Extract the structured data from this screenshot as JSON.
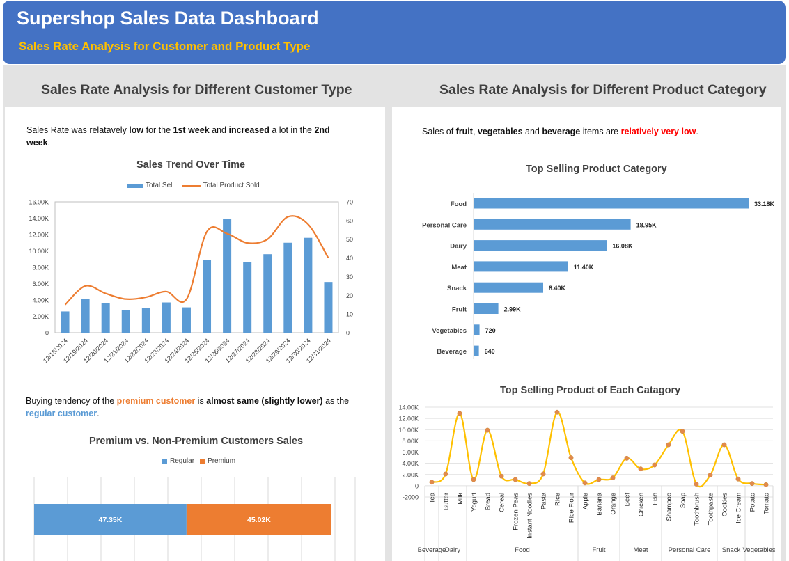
{
  "header": {
    "title": "Supershop Sales Data Dashboard",
    "subtitle": "Sales Rate Analysis for Customer and Product Type"
  },
  "left": {
    "section_title": "Sales Rate Analysis for Different Customer Type",
    "note1": {
      "parts": [
        "Sales Rate was relatavely ",
        "low",
        " for the ",
        "1st week",
        " and ",
        "increased",
        " a lot in the ",
        "2nd week",
        "."
      ]
    },
    "note2": {
      "parts": [
        "Buying tendency of the ",
        "premium customer",
        " is ",
        "almost same (slightly lower)",
        " as the ",
        "regular customer",
        "."
      ]
    }
  },
  "right": {
    "section_title": "Sales Rate Analysis for Different Product Category",
    "note": {
      "parts": [
        "Sales of ",
        "fruit",
        ", ",
        "vegetables",
        " and ",
        "beverage",
        " items are ",
        "relatively very low",
        "."
      ]
    }
  },
  "colors": {
    "header_bg": "#4472c4",
    "subtitle": "#ffc000",
    "bar_blue": "#5b9bd5",
    "orange": "#ed7d31",
    "gold_line": "#ffc000",
    "red_text": "#ff0000"
  },
  "chart_data": [
    {
      "id": "trend",
      "type": "bar",
      "title": "Sales Trend Over Time",
      "categories": [
        "12/18/2024",
        "12/19/2024",
        "12/20/2024",
        "12/21/2024",
        "12/22/2024",
        "12/23/2024",
        "12/24/2024",
        "12/25/2024",
        "12/26/2024",
        "12/27/2024",
        "12/28/2024",
        "12/29/2024",
        "12/30/2024",
        "12/31/2024"
      ],
      "series": [
        {
          "name": "Total Sell",
          "type": "bar",
          "axis": "left",
          "values": [
            2600,
            4100,
            3600,
            2800,
            3000,
            3700,
            3100,
            8900,
            13900,
            8600,
            9600,
            11000,
            11600,
            6200
          ]
        },
        {
          "name": "Total Product Sold",
          "type": "line",
          "axis": "right",
          "values": [
            15,
            25,
            21,
            18,
            19,
            22,
            18,
            54,
            53,
            48,
            50,
            62,
            58,
            40
          ]
        }
      ],
      "y_left": {
        "min": 0,
        "max": 16000,
        "ticks": [
          "0",
          "2.00K",
          "4.00K",
          "6.00K",
          "8.00K",
          "10.00K",
          "12.00K",
          "14.00K",
          "16.00K"
        ]
      },
      "y_right": {
        "min": 0,
        "max": 70,
        "ticks": [
          "0",
          "10",
          "20",
          "30",
          "40",
          "50",
          "60",
          "70"
        ]
      },
      "legend": "top"
    },
    {
      "id": "customer",
      "type": "bar",
      "orientation": "horizontal-stacked",
      "title": "Premium vs. Non-Premium Customers Sales",
      "series": [
        {
          "name": "Regular",
          "value": 47350,
          "label": "47.35K"
        },
        {
          "name": "Premium",
          "value": 45020,
          "label": "45.02K"
        }
      ],
      "legend": "top"
    },
    {
      "id": "category",
      "type": "bar",
      "orientation": "horizontal",
      "title": "Top Selling Product Category",
      "categories": [
        "Food",
        "Personal Care",
        "Dairy",
        "Meat",
        "Snack",
        "Fruit",
        "Vegetables",
        "Beverage"
      ],
      "values": [
        33180,
        18950,
        16080,
        11400,
        8400,
        2990,
        720,
        640
      ],
      "labels": [
        "33.18K",
        "18.95K",
        "16.08K",
        "11.40K",
        "8.40K",
        "2.99K",
        "720",
        "640"
      ]
    },
    {
      "id": "products",
      "type": "line",
      "title": "Top Selling Product of Each Catagory",
      "products": [
        "Tea",
        "Butter",
        "Milk",
        "Yogurt",
        "Bread",
        "Cereal",
        "Frozen Peas",
        "Instant Noodles",
        "Pasta",
        "Rice",
        "Rice Flour",
        "Apple",
        "Banana",
        "Orange",
        "Beef",
        "Chicken",
        "Fish",
        "Shampoo",
        "Soap",
        "Toothbrush",
        "Toothpaste",
        "Cookies",
        "Ice Cream",
        "Potato",
        "Tomato"
      ],
      "values": [
        640,
        2100,
        12900,
        1100,
        9900,
        1700,
        1100,
        400,
        2100,
        13100,
        5000,
        500,
        1100,
        1400,
        4900,
        3000,
        3700,
        7300,
        9700,
        300,
        1900,
        7300,
        1200,
        400,
        200
      ],
      "groups": [
        {
          "name": "Beverage",
          "count": 1
        },
        {
          "name": "Dairy",
          "count": 2
        },
        {
          "name": "Food",
          "count": 8
        },
        {
          "name": "Fruit",
          "count": 3
        },
        {
          "name": "Meat",
          "count": 3
        },
        {
          "name": "Personal Care",
          "count": 4
        },
        {
          "name": "Snack",
          "count": 2
        },
        {
          "name": "Vegetables",
          "count": 2
        }
      ],
      "y": {
        "min": -2000,
        "max": 14000,
        "ticks": [
          "-2000",
          "0",
          "2.00K",
          "4.00K",
          "6.00K",
          "8.00K",
          "10.00K",
          "12.00K",
          "14.00K"
        ]
      }
    }
  ]
}
